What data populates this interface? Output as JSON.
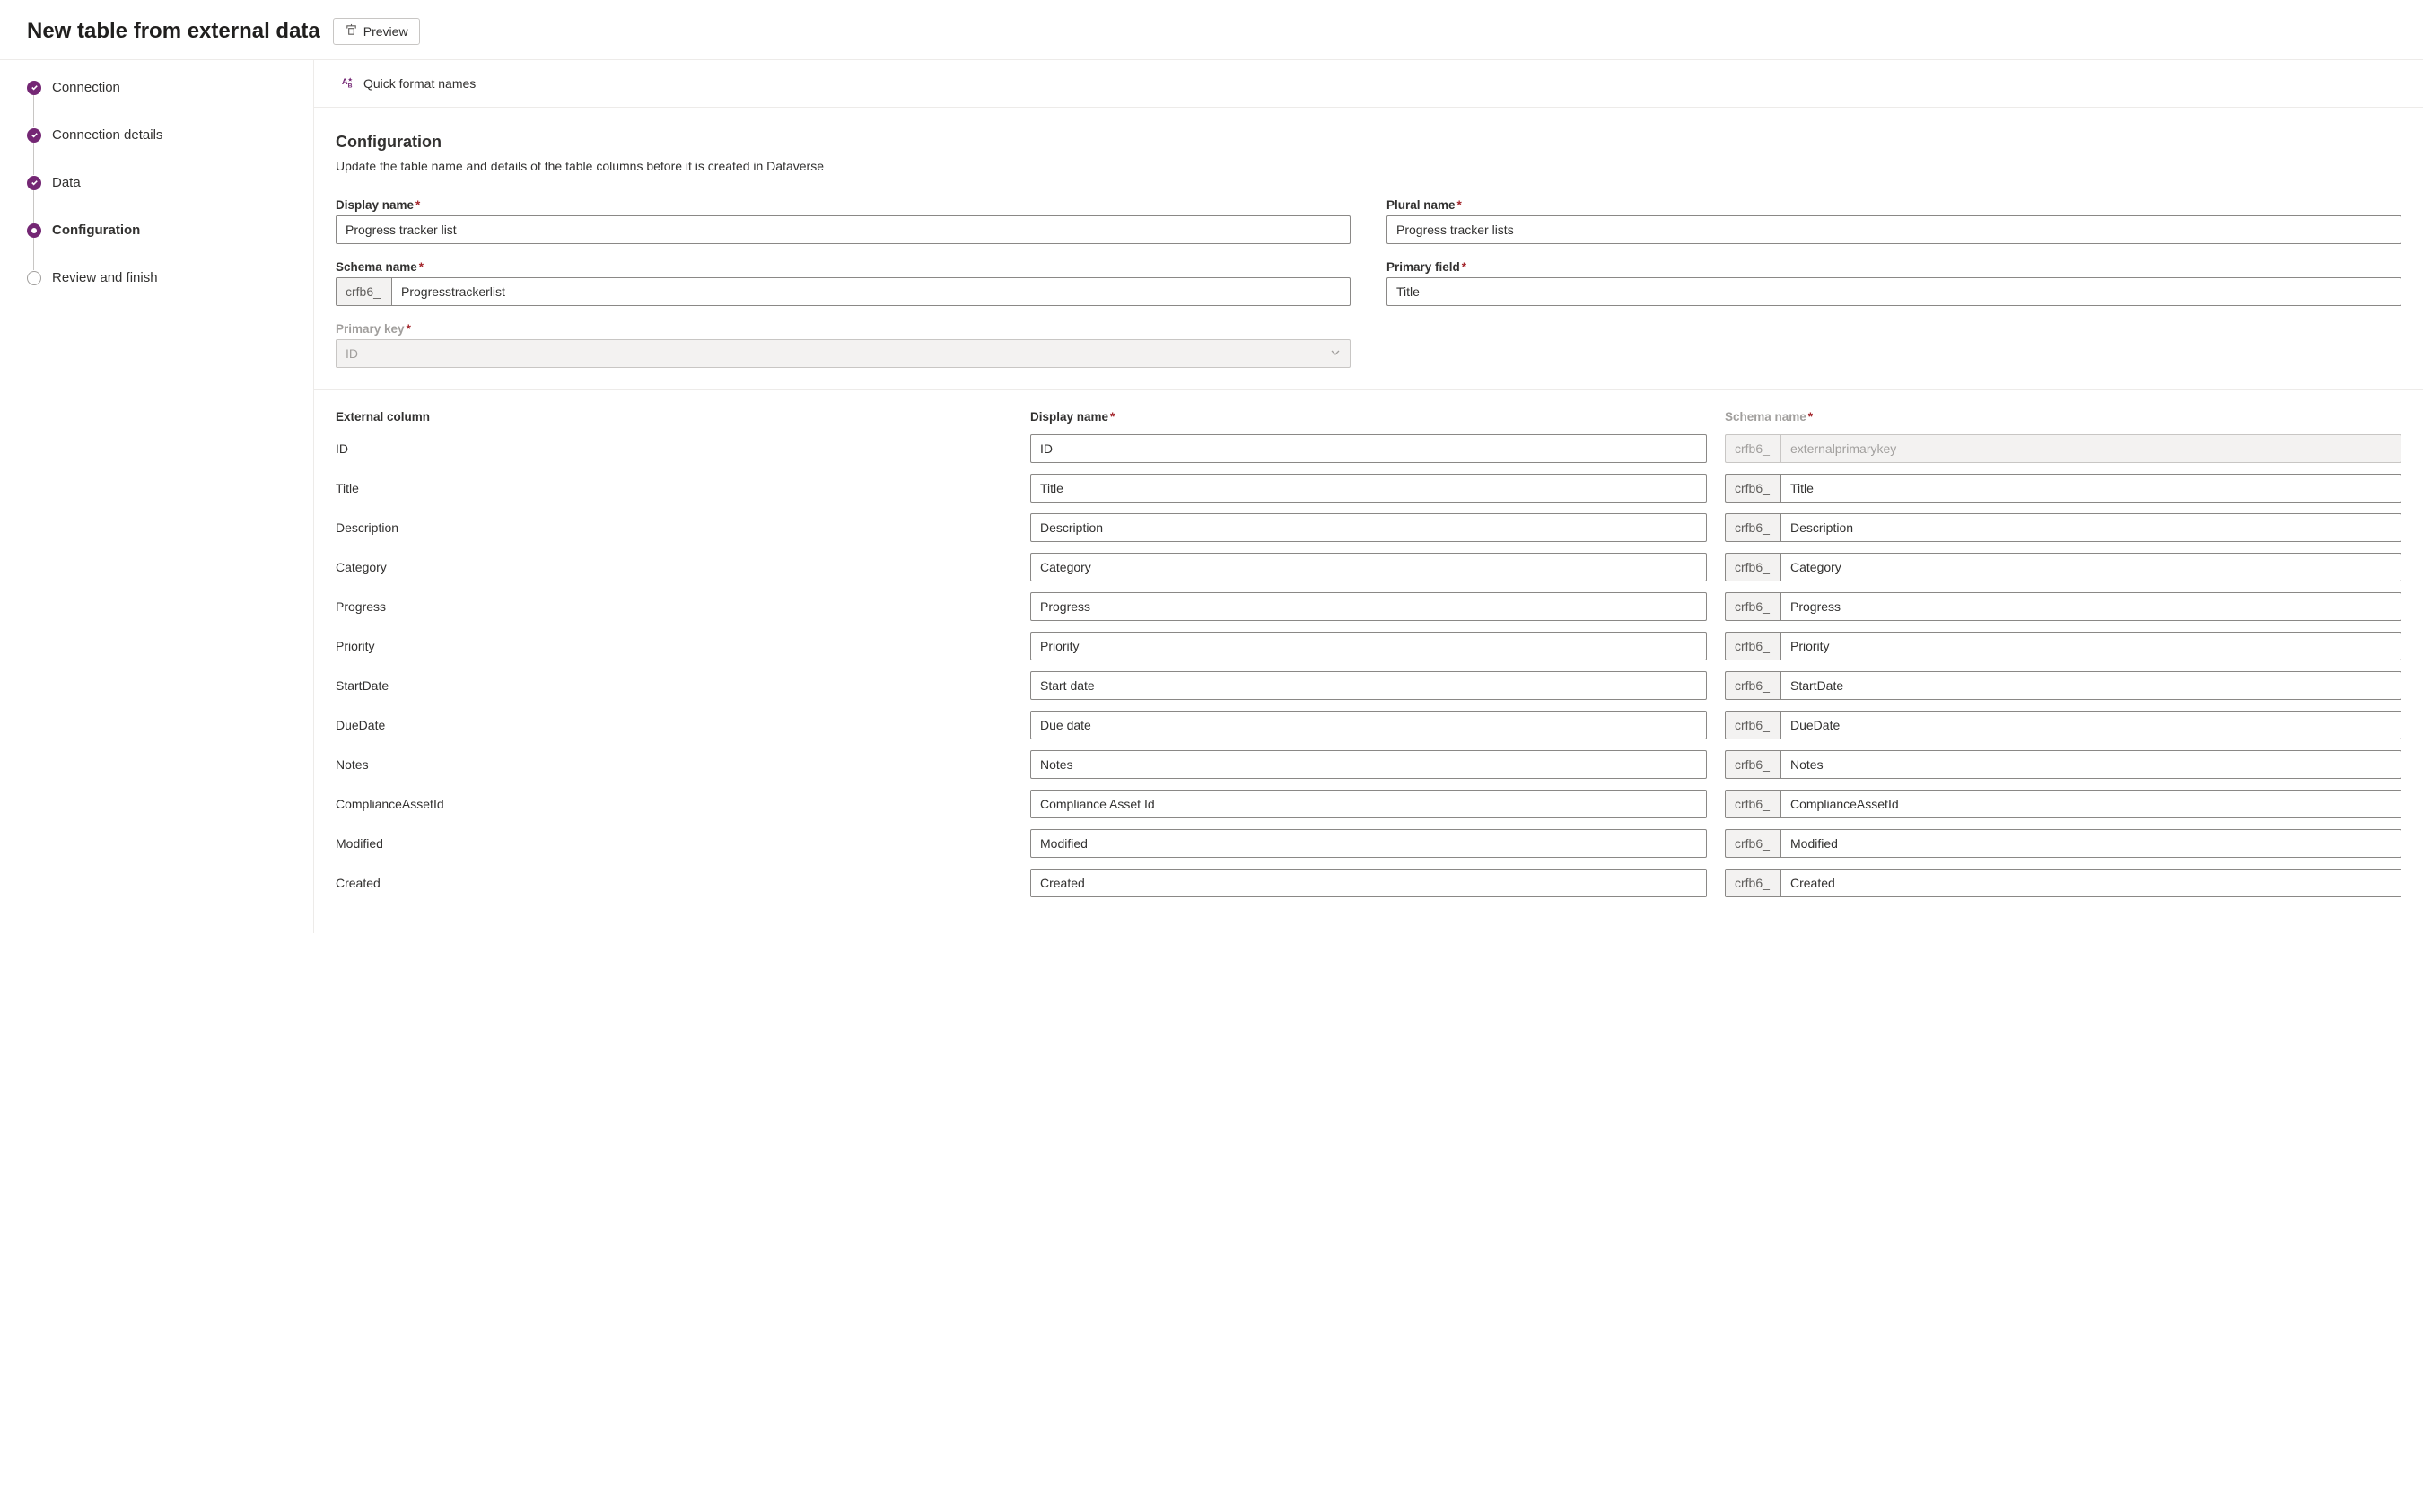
{
  "header": {
    "title": "New table from external data",
    "preview_label": "Preview"
  },
  "steps": [
    {
      "label": "Connection",
      "state": "done"
    },
    {
      "label": "Connection details",
      "state": "done"
    },
    {
      "label": "Data",
      "state": "done"
    },
    {
      "label": "Configuration",
      "state": "current"
    },
    {
      "label": "Review and finish",
      "state": "pending"
    }
  ],
  "command_bar": {
    "quick_format": "Quick format names"
  },
  "config": {
    "heading": "Configuration",
    "subtext": "Update the table name and details of the table columns before it is created in Dataverse",
    "fields": {
      "display_name": {
        "label": "Display name",
        "value": "Progress tracker list"
      },
      "plural_name": {
        "label": "Plural name",
        "value": "Progress tracker lists"
      },
      "schema_name": {
        "label": "Schema name",
        "prefix": "crfb6_",
        "value": "Progresstrackerlist"
      },
      "primary_field": {
        "label": "Primary field",
        "value": "Title"
      },
      "primary_key": {
        "label": "Primary key",
        "value": "ID"
      }
    }
  },
  "columns": {
    "headers": {
      "external": "External column",
      "display": "Display name",
      "schema": "Schema name"
    },
    "schema_prefix": "crfb6_",
    "rows": [
      {
        "external": "ID",
        "display": "ID",
        "schema": "externalprimarykey",
        "schema_disabled": true
      },
      {
        "external": "Title",
        "display": "Title",
        "schema": "Title"
      },
      {
        "external": "Description",
        "display": "Description",
        "schema": "Description"
      },
      {
        "external": "Category",
        "display": "Category",
        "schema": "Category"
      },
      {
        "external": "Progress",
        "display": "Progress",
        "schema": "Progress"
      },
      {
        "external": "Priority",
        "display": "Priority",
        "schema": "Priority"
      },
      {
        "external": "StartDate",
        "display": "Start date",
        "schema": "StartDate"
      },
      {
        "external": "DueDate",
        "display": "Due date",
        "schema": "DueDate"
      },
      {
        "external": "Notes",
        "display": "Notes",
        "schema": "Notes"
      },
      {
        "external": "ComplianceAssetId",
        "display": "Compliance Asset Id",
        "schema": "ComplianceAssetId"
      },
      {
        "external": "Modified",
        "display": "Modified",
        "schema": "Modified"
      },
      {
        "external": "Created",
        "display": "Created",
        "schema": "Created"
      }
    ]
  }
}
